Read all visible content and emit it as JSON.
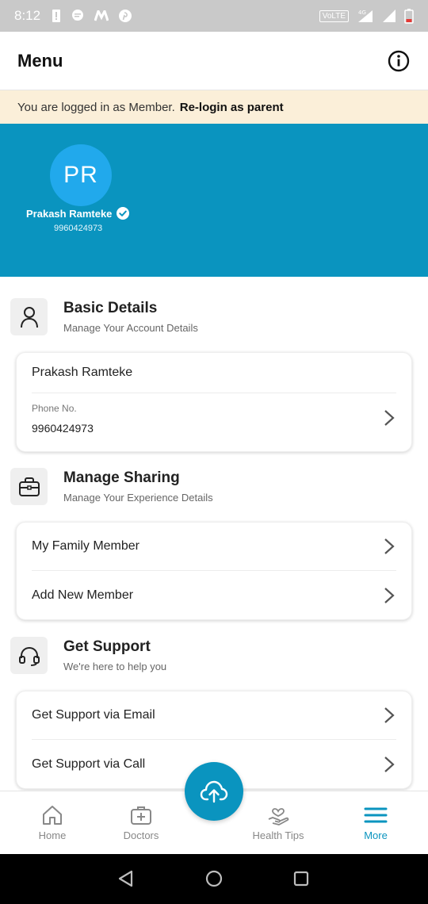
{
  "status_bar": {
    "time": "8:12",
    "network_badge": "VoLTE",
    "network_type": "4G"
  },
  "header": {
    "title": "Menu",
    "info_icon": "info-icon"
  },
  "banner": {
    "text": "You are logged in as Member.",
    "action": "Re-login as parent"
  },
  "profile": {
    "initials": "PR",
    "name": "Prakash Ramteke",
    "phone": "9960424973",
    "verified_icon": "verified-check-icon"
  },
  "basic_details": {
    "title": "Basic Details",
    "subtitle": "Manage Your Account Details",
    "icon": "person-icon",
    "name": "Prakash Ramteke",
    "phone_label": "Phone No.",
    "phone_value": "9960424973"
  },
  "manage_sharing": {
    "title": "Manage Sharing",
    "subtitle": "Manage Your Experience Details",
    "icon": "briefcase-icon",
    "items": [
      "My Family Member",
      "Add New Member"
    ]
  },
  "get_support": {
    "title": "Get Support",
    "subtitle": "We're here to help you",
    "icon": "headset-icon",
    "items": [
      "Get Support via Email",
      "Get Support via Call"
    ]
  },
  "bottom_nav": {
    "items": [
      {
        "label": "Home",
        "icon": "home-icon"
      },
      {
        "label": "Doctors",
        "icon": "medical-kit-icon"
      },
      {
        "label": "Health Tips",
        "icon": "health-tips-icon"
      },
      {
        "label": "More",
        "icon": "menu-icon"
      }
    ],
    "active": "More",
    "fab_icon": "cloud-upload-icon"
  },
  "colors": {
    "primary": "#0a94bf",
    "avatar": "#21a9ec",
    "banner_bg": "#fbefd9"
  }
}
